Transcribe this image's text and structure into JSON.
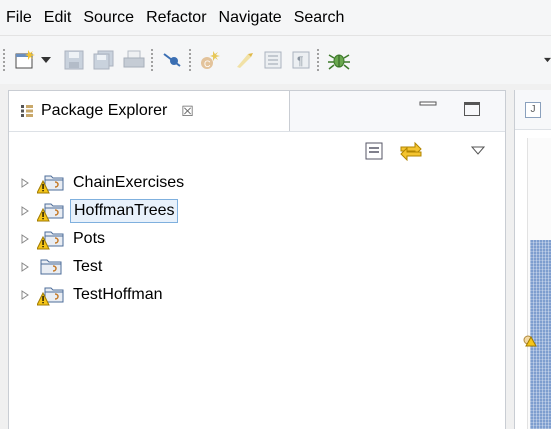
{
  "menu": {
    "items": [
      "File",
      "Edit",
      "Source",
      "Refactor",
      "Navigate",
      "Search"
    ]
  },
  "toolbar": {
    "icons": [
      "new-wizard-icon",
      "dropdown-arrow-icon",
      "save-icon",
      "save-all-icon",
      "print-icon",
      "skip-breakpoints-icon",
      "new-class-icon",
      "toggle-mark-occurrences-icon",
      "show-whitespace-icon",
      "pilcrow-icon",
      "debug-icon"
    ]
  },
  "package_explorer": {
    "title": "Package Explorer",
    "close_glyph": "☒",
    "projects": [
      {
        "name": "ChainExercises",
        "warning": true,
        "selected": false
      },
      {
        "name": "HoffmanTrees",
        "warning": true,
        "selected": true
      },
      {
        "name": "Pots",
        "warning": true,
        "selected": false
      },
      {
        "name": "Test",
        "warning": false,
        "selected": false
      },
      {
        "name": "TestHoffman",
        "warning": true,
        "selected": false
      }
    ]
  },
  "editor": {
    "tab_glyph": "J"
  },
  "colors": {
    "selection_border": "#7fb0de",
    "selection_fill": "#e8f1fb",
    "overview_ruler": "#7e9ecf"
  }
}
